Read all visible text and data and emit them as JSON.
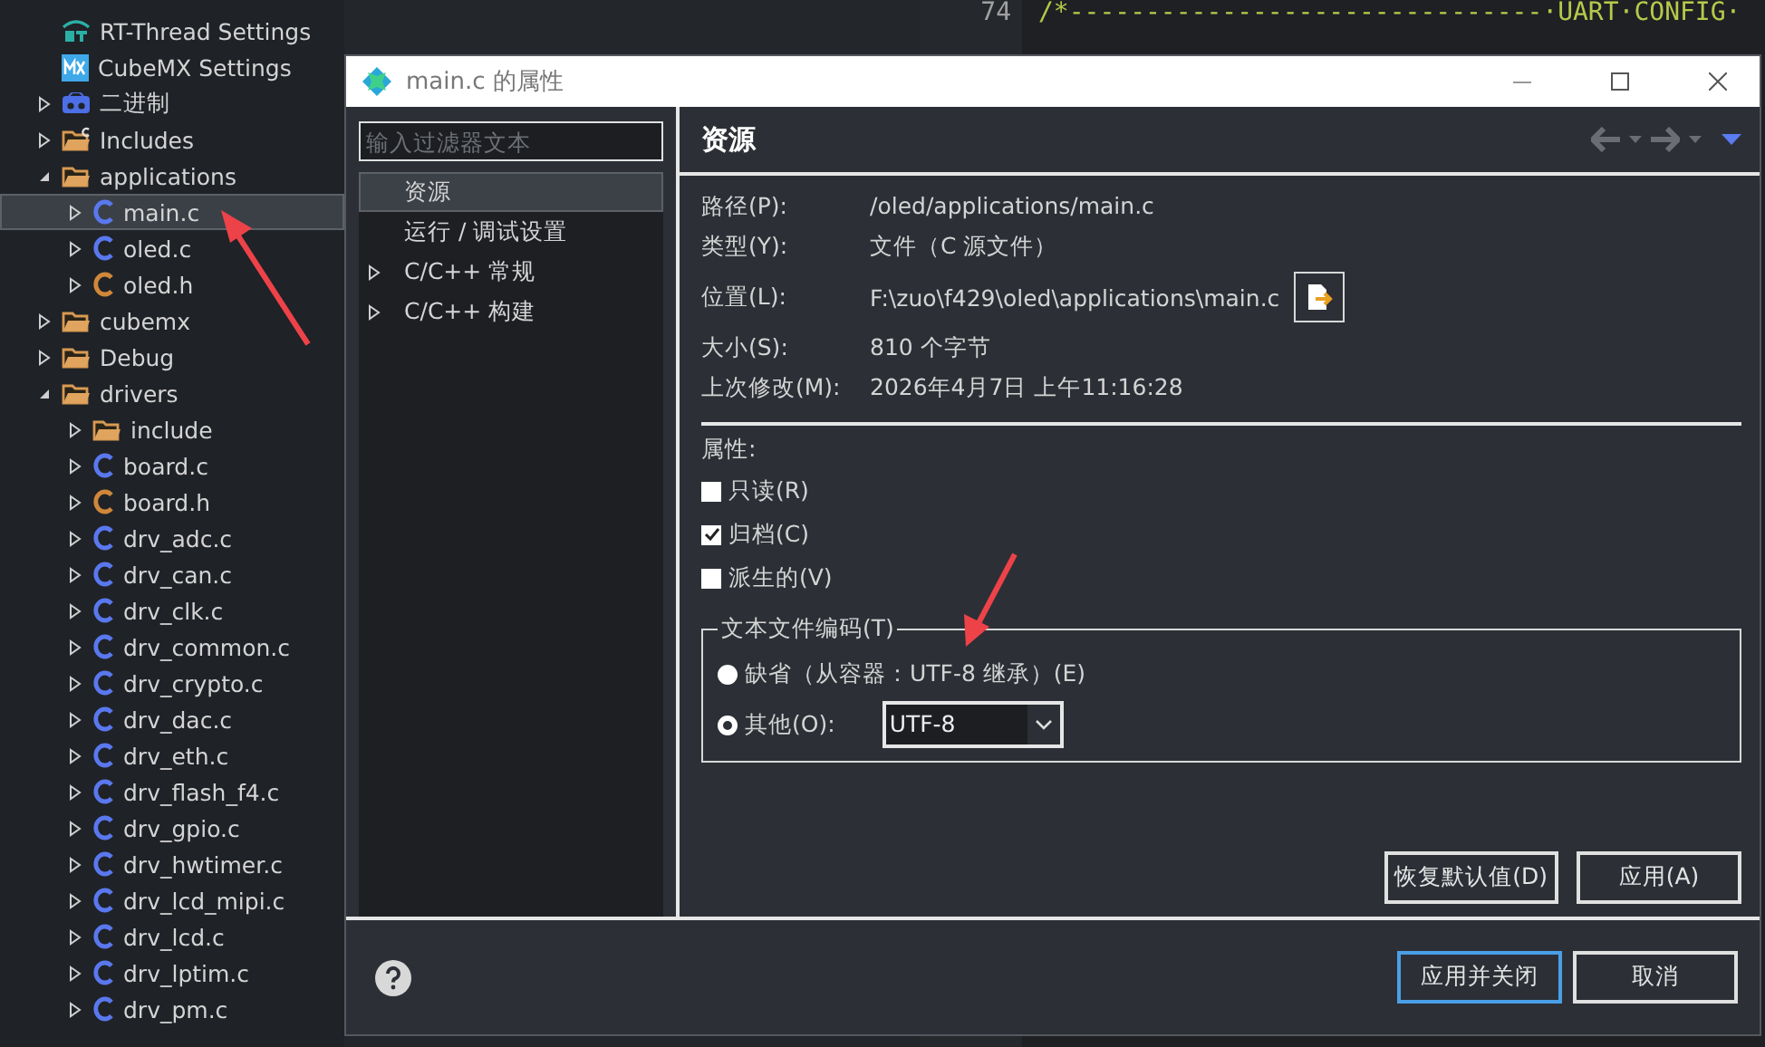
{
  "tree": {
    "items": [
      {
        "label": "RT-Thread Settings",
        "kind": "rt-settings",
        "selected": false
      },
      {
        "label": "CubeMX Settings",
        "kind": "mx-settings",
        "selected": false
      },
      {
        "label": "二进制",
        "kind": "binaries",
        "expanded": false,
        "selected": false
      },
      {
        "label": "Includes",
        "kind": "includes",
        "expanded": false,
        "selected": false
      },
      {
        "label": "applications",
        "kind": "folder",
        "expanded": true,
        "selected": false,
        "children": [
          {
            "label": "main.c",
            "kind": "c-file",
            "expanded": false,
            "selected": true
          },
          {
            "label": "oled.c",
            "kind": "c-file",
            "expanded": false,
            "selected": false
          },
          {
            "label": "oled.h",
            "kind": "h-file",
            "expanded": false,
            "selected": false
          }
        ]
      },
      {
        "label": "cubemx",
        "kind": "folder",
        "expanded": false,
        "selected": false
      },
      {
        "label": "Debug",
        "kind": "folder",
        "expanded": false,
        "selected": false
      },
      {
        "label": "drivers",
        "kind": "folder",
        "expanded": true,
        "selected": false,
        "children": [
          {
            "label": "include",
            "kind": "folder",
            "expanded": false,
            "selected": false
          },
          {
            "label": "board.c",
            "kind": "c-file",
            "expanded": false,
            "selected": false
          },
          {
            "label": "board.h",
            "kind": "h-file",
            "expanded": false,
            "selected": false
          },
          {
            "label": "drv_adc.c",
            "kind": "c-file",
            "expanded": false,
            "selected": false
          },
          {
            "label": "drv_can.c",
            "kind": "c-file",
            "expanded": false,
            "selected": false
          },
          {
            "label": "drv_clk.c",
            "kind": "c-file",
            "expanded": false,
            "selected": false
          },
          {
            "label": "drv_common.c",
            "kind": "c-file",
            "expanded": false,
            "selected": false
          },
          {
            "label": "drv_crypto.c",
            "kind": "c-file",
            "expanded": false,
            "selected": false
          },
          {
            "label": "drv_dac.c",
            "kind": "c-file",
            "expanded": false,
            "selected": false
          },
          {
            "label": "drv_eth.c",
            "kind": "c-file",
            "expanded": false,
            "selected": false
          },
          {
            "label": "drv_flash_f4.c",
            "kind": "c-file",
            "expanded": false,
            "selected": false
          },
          {
            "label": "drv_gpio.c",
            "kind": "c-file",
            "expanded": false,
            "selected": false
          },
          {
            "label": "drv_hwtimer.c",
            "kind": "c-file",
            "expanded": false,
            "selected": false
          },
          {
            "label": "drv_lcd_mipi.c",
            "kind": "c-file",
            "expanded": false,
            "selected": false
          },
          {
            "label": "drv_lcd.c",
            "kind": "c-file",
            "expanded": false,
            "selected": false
          },
          {
            "label": "drv_lptim.c",
            "kind": "c-file",
            "expanded": false,
            "selected": false
          },
          {
            "label": "drv_pm.c",
            "kind": "c-file",
            "expanded": false,
            "selected": false
          }
        ]
      }
    ]
  },
  "editor": {
    "lines": [
      {
        "number": "74",
        "code": "/*-------------------------------·UART·CONFIG·"
      }
    ]
  },
  "dialog": {
    "title": "main.c 的属性",
    "filter": {
      "placeholder": "输入过滤器文本"
    },
    "nav": [
      {
        "label": "资源",
        "kind": "page",
        "selected": true
      },
      {
        "label": "运行 / 调试设置",
        "kind": "page",
        "selected": false
      },
      {
        "label": "C/C++ 常规",
        "kind": "group",
        "selected": false
      },
      {
        "label": "C/C++ 构建",
        "kind": "group",
        "selected": false
      }
    ],
    "heading": "资源",
    "info": [
      {
        "label": "路径(P):",
        "value": "/oled/applications/main.c",
        "kind": "text"
      },
      {
        "label": "类型(Y):",
        "value": "文件（C 源文件）",
        "kind": "text"
      },
      {
        "label": "位置(L):",
        "value": "F:\\zuo\\f429\\oled\\applications\\main.c",
        "kind": "location"
      },
      {
        "label": "大小(S):",
        "value": "810 个字节",
        "kind": "text"
      },
      {
        "label": "上次修改(M):",
        "value": "2026年4月7日 上午11:16:28",
        "kind": "text"
      }
    ],
    "attributes_label": "属性:",
    "attributes": [
      {
        "label": "只读(R)",
        "checked": false
      },
      {
        "label": "归档(C)",
        "checked": true
      },
      {
        "label": "派生的(V)",
        "checked": false
      }
    ],
    "encoding": {
      "title": "文本文件编码(T)",
      "options": [
        {
          "label": "缺省（从容器：UTF-8 继承）(E)",
          "kind": "plain",
          "selected": false
        },
        {
          "label": "其他(O):",
          "kind": "combo",
          "selected": true,
          "value": "UTF-8"
        }
      ]
    },
    "page_buttons": [
      "恢复默认值(D)",
      "应用(A)"
    ],
    "footer_buttons": [
      {
        "label": "应用并关闭",
        "primary": true
      },
      {
        "label": "取消",
        "primary": false
      }
    ]
  }
}
